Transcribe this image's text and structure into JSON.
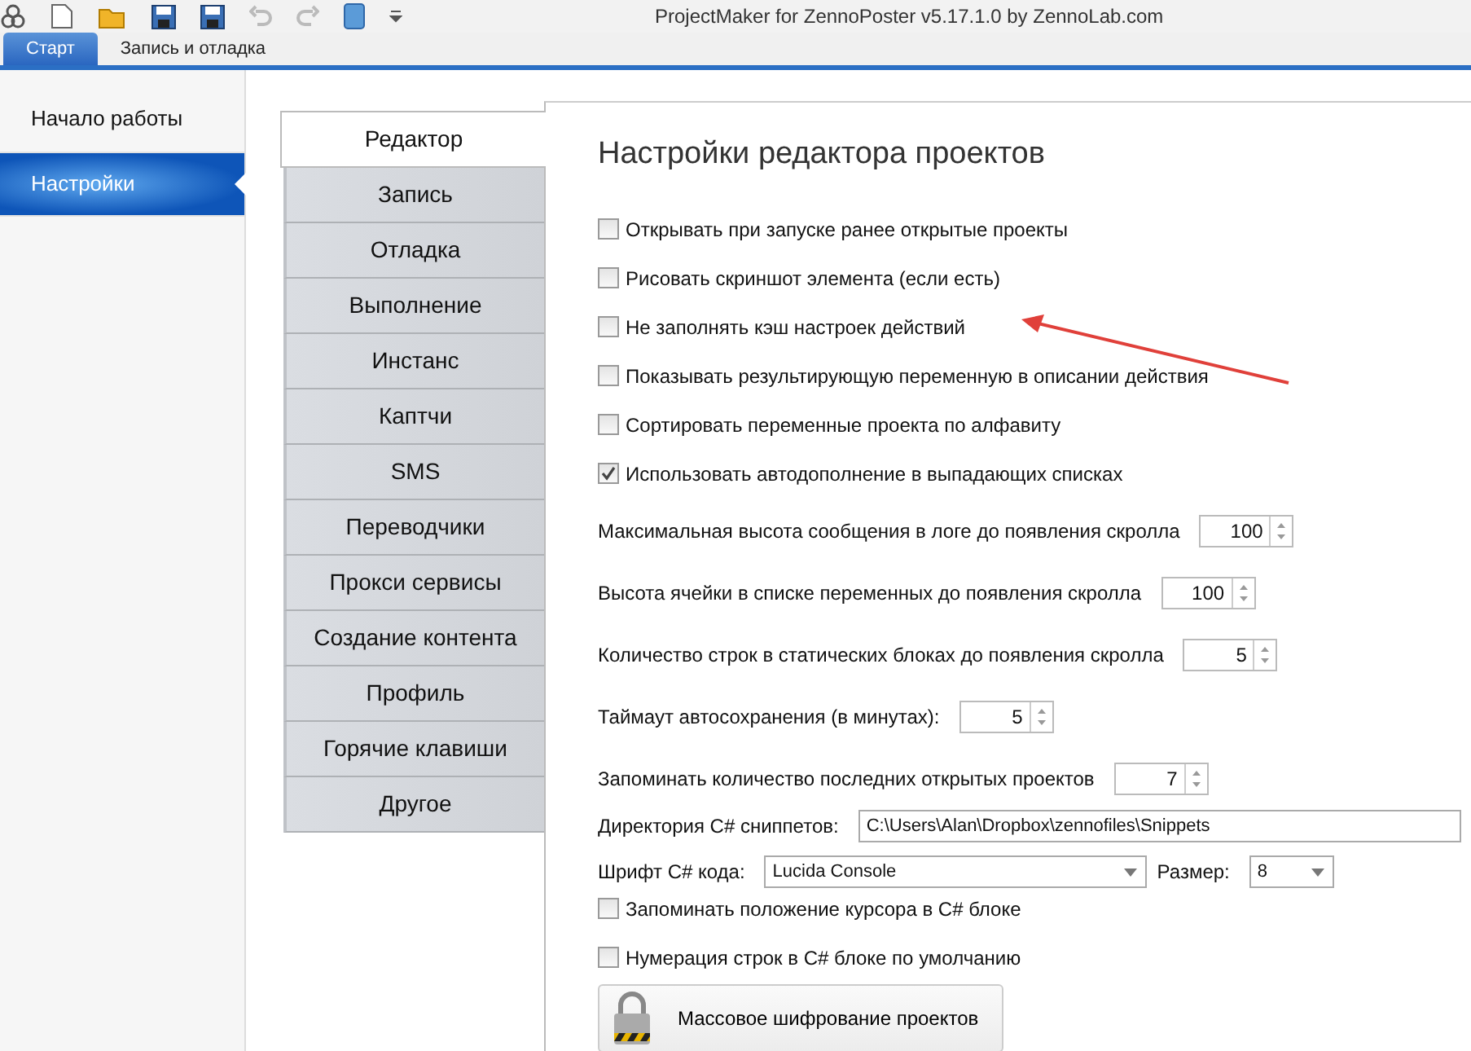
{
  "window": {
    "title": "ProjectMaker for ZennoPoster v5.17.1.0 by ZennoLab.com"
  },
  "ribbon_tabs": [
    {
      "label": "Старт",
      "selected": true
    },
    {
      "label": "Запись и отладка",
      "selected": false
    }
  ],
  "sidebar": {
    "items": [
      {
        "label": "Начало работы",
        "selected": false
      },
      {
        "label": "Настройки",
        "selected": true
      }
    ]
  },
  "settings_tabs": [
    {
      "label": "Редактор",
      "selected": true
    },
    {
      "label": "Запись",
      "selected": false
    },
    {
      "label": "Отладка",
      "selected": false
    },
    {
      "label": "Выполнение",
      "selected": false
    },
    {
      "label": "Инстанс",
      "selected": false
    },
    {
      "label": "Каптчи",
      "selected": false
    },
    {
      "label": "SMS",
      "selected": false
    },
    {
      "label": "Переводчики",
      "selected": false
    },
    {
      "label": "Прокси сервисы",
      "selected": false
    },
    {
      "label": "Создание контента",
      "selected": false
    },
    {
      "label": "Профиль",
      "selected": false
    },
    {
      "label": "Горячие клавиши",
      "selected": false
    },
    {
      "label": "Другое",
      "selected": false
    }
  ],
  "heading": "Настройки редактора проектов",
  "options": [
    {
      "label": "Открывать при запуске ранее открытые проекты",
      "checked": false
    },
    {
      "label": "Рисовать скриншот элемента (если есть)",
      "checked": false
    },
    {
      "label": "Не заполнять кэш настроек действий",
      "checked": false
    },
    {
      "label": "Показывать результирующую переменную в описании действия",
      "checked": false
    },
    {
      "label": "Сортировать переменные проекта по алфавиту",
      "checked": false
    },
    {
      "label": "Использовать автодополнение в выпадающих списках",
      "checked": true
    }
  ],
  "spinners": [
    {
      "label": "Максимальная высота сообщения в логе до появления скролла",
      "value": "100"
    },
    {
      "label": "Высота ячейки в списке переменных до появления скролла",
      "value": "100"
    },
    {
      "label": "Количество строк в статических блоках до появления скролла",
      "value": "5"
    },
    {
      "label": "Таймаут автосохранения (в минутах):",
      "value": "5"
    },
    {
      "label": "Запоминать количество последних открытых проектов",
      "value": "7"
    }
  ],
  "snippets_dir": {
    "label": "Директория C# сниппетов:",
    "value": "C:\\Users\\Alan\\Dropbox\\zennofiles\\Snippets"
  },
  "font": {
    "label": "Шрифт C# кода:",
    "value": "Lucida Console",
    "size_label": "Размер:",
    "size_value": "8"
  },
  "options_2": [
    {
      "label": "Запоминать положение курсора в C# блоке",
      "checked": false
    },
    {
      "label": "Нумерация строк в C# блоке по умолчанию",
      "checked": false
    }
  ],
  "encrypt_button": "Массовое шифрование проектов"
}
